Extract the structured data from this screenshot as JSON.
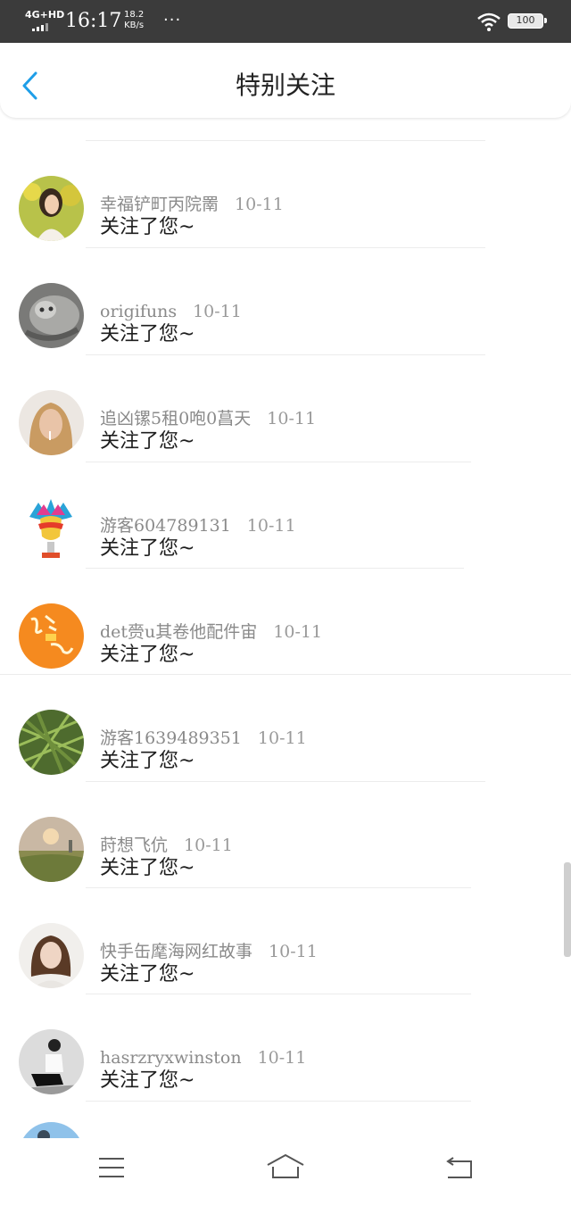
{
  "status_bar": {
    "network": "4G+HD",
    "time": "16:17",
    "speed_value": "18.2",
    "speed_unit": "KB/s",
    "more": "···",
    "battery": "100"
  },
  "header": {
    "title": "特别关注"
  },
  "items": [
    {
      "name": "幸福铲町丙院罱",
      "date": "10-11",
      "message": "关注了您~",
      "avatar": "girl-flowers"
    },
    {
      "name": "origifuns",
      "date": "10-11",
      "message": "关注了您~",
      "avatar": "cat"
    },
    {
      "name": "追凶镙5租0咆0菖天",
      "date": "10-11",
      "message": "关注了您~",
      "avatar": "blonde-girl"
    },
    {
      "name": "游客604789131",
      "date": "10-11",
      "message": "关注了您~",
      "avatar": "mask"
    },
    {
      "name": "det赍u其卷他配件宙",
      "date": "10-11",
      "message": "关注了您~",
      "avatar": "orange-calligraphy"
    },
    {
      "name": "游客1639489351",
      "date": "10-11",
      "message": "关注了您~",
      "avatar": "grass"
    },
    {
      "name": "莳想飞伉",
      "date": "10-11",
      "message": "关注了您~",
      "avatar": "sunset-field"
    },
    {
      "name": "快手缶麾海网红故事",
      "date": "10-11",
      "message": "关注了您~",
      "avatar": "brunette-girl"
    },
    {
      "name": "hasrzryxwinston",
      "date": "10-11",
      "message": "关注了您~",
      "avatar": "bw-man"
    }
  ],
  "icons": {
    "back": "chevron-left-icon",
    "menu": "menu-icon",
    "home": "home-icon",
    "return": "return-icon"
  },
  "colors": {
    "accent": "#1e9ee8",
    "status_bar": "#3b3b3b"
  }
}
